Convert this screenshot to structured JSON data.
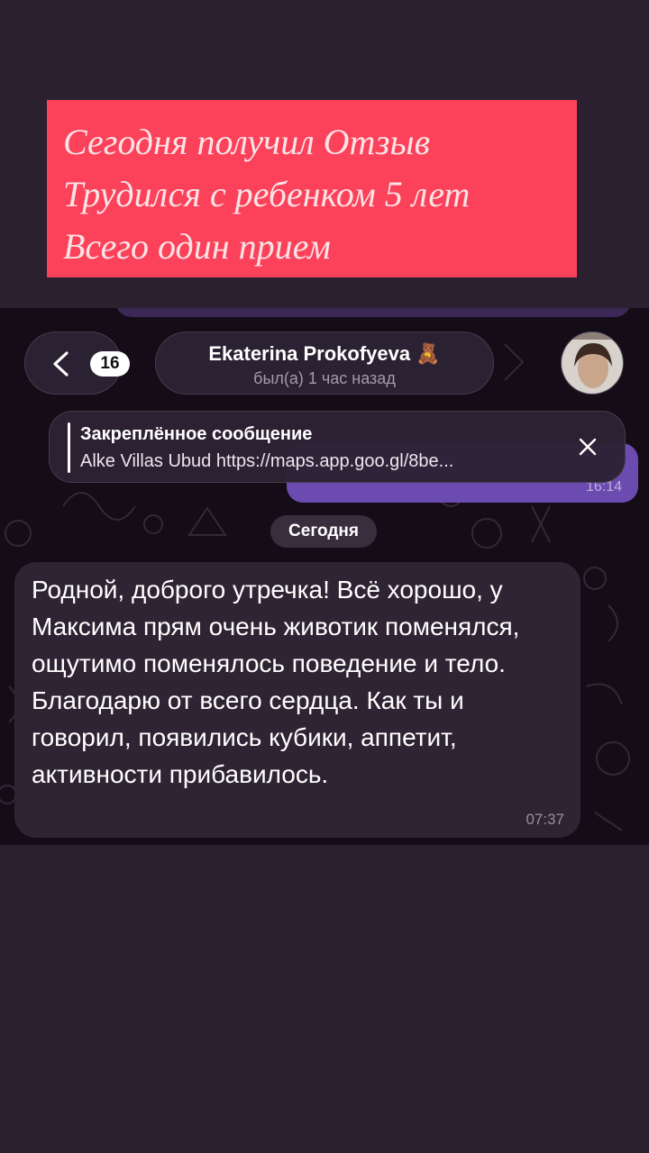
{
  "caption": {
    "lines": [
      "Сегодня получил Отзыв",
      "Трудился с ребенком 5 лет",
      "Всего один прием"
    ]
  },
  "chat": {
    "back_badge": "16",
    "contact_name": "Ekaterina Prokofyeva 🧸",
    "contact_status": "был(а) 1 час назад",
    "pinned_title": "Закреплённое сообщение",
    "pinned_text": "Alke Villas Ubud https://maps.app.goo.gl/8be...",
    "sent_time": "16:14",
    "date_label": "Сегодня",
    "message_text": "Родной, доброго утречка! Всё хорошо, у Максима прям очень животик поменялся, ощутимо поменялось поведение и тело. Благодарю от всего сердца. Как ты и говорил, появились кубики, аппетит, активности прибавилось.",
    "message_time": "07:37"
  },
  "colors": {
    "page_bg": "#2a2030",
    "caption_bg": "#fb425a",
    "caption_text": "#fbe3e6",
    "chat_bg": "#140c17",
    "incoming_bubble": "#2f2433",
    "outgoing_bubble": "#6c4bb0"
  },
  "icons": [
    "chevron-left-icon",
    "close-icon",
    "avatar"
  ]
}
